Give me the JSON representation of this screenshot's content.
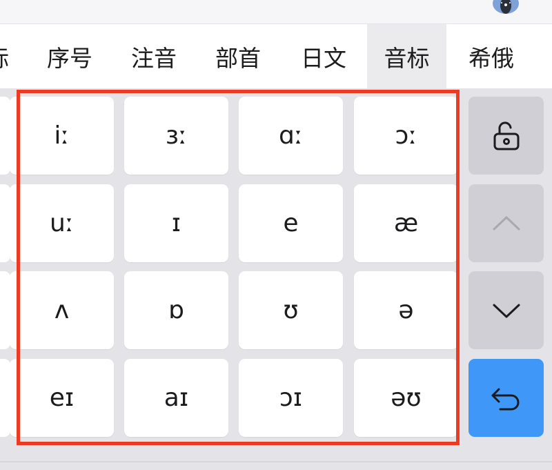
{
  "tabs": [
    {
      "label": "标",
      "active": false
    },
    {
      "label": "序号",
      "active": false
    },
    {
      "label": "注音",
      "active": false
    },
    {
      "label": "部首",
      "active": false
    },
    {
      "label": "日文",
      "active": false
    },
    {
      "label": "音标",
      "active": true
    },
    {
      "label": "希俄",
      "active": false
    }
  ],
  "symbols": [
    [
      "iː",
      "ɜː",
      "ɑː",
      "ɔː"
    ],
    [
      "uː",
      "ɪ",
      "e",
      "æ"
    ],
    [
      "ʌ",
      "ɒ",
      "ʊ",
      "ə"
    ],
    [
      "eɪ",
      "aɪ",
      "ɔɪ",
      "əʊ"
    ]
  ],
  "side_keys": [
    {
      "icon": "lock-open-icon"
    },
    {
      "icon": "chevron-up-icon"
    },
    {
      "icon": "chevron-down-icon"
    },
    {
      "icon": "return-icon"
    }
  ],
  "colors": {
    "highlight_border": "#ed3b23",
    "enter_key": "#3f97f7",
    "active_tab_bg": "#ebebed",
    "keyboard_bg": "#e3e3e8"
  }
}
